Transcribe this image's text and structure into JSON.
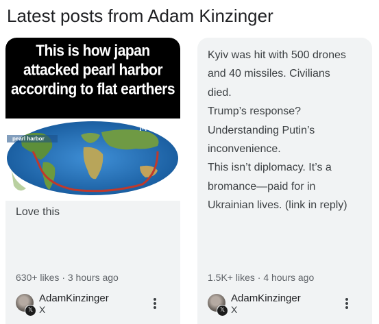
{
  "section_title": "Latest posts from Adam Kinzinger",
  "posts": [
    {
      "image": {
        "meme_lines": [
          "This is how japan",
          "attacked pearl harbor",
          "according to flat earthers"
        ],
        "map_labels": [
          "pearl harbor",
          "japan"
        ]
      },
      "text": "Love this",
      "meta": "630+ likes · 3 hours ago",
      "author": "AdamKinzinger",
      "source": "X",
      "source_icon": "x-logo-icon",
      "more_icon": "more-vert-icon"
    },
    {
      "text_lines": [
        "Kyiv was hit with 500 drones",
        "and 40 missiles. Civilians",
        "died.",
        "Trump’s response?",
        "Understanding Putin’s",
        "inconvenience.",
        "This isn’t diplomacy. It’s a",
        "bromance—paid for in",
        "Ukrainian lives. (link in reply)"
      ],
      "meta": "1.5K+ likes · 4 hours ago",
      "author": "AdamKinzinger",
      "source": "X",
      "source_icon": "x-logo-icon",
      "more_icon": "more-vert-icon"
    }
  ],
  "colors": {
    "card_bg": "#f1f3f4",
    "map_route": "#c0392b",
    "ocean": "#1f6fb8"
  }
}
